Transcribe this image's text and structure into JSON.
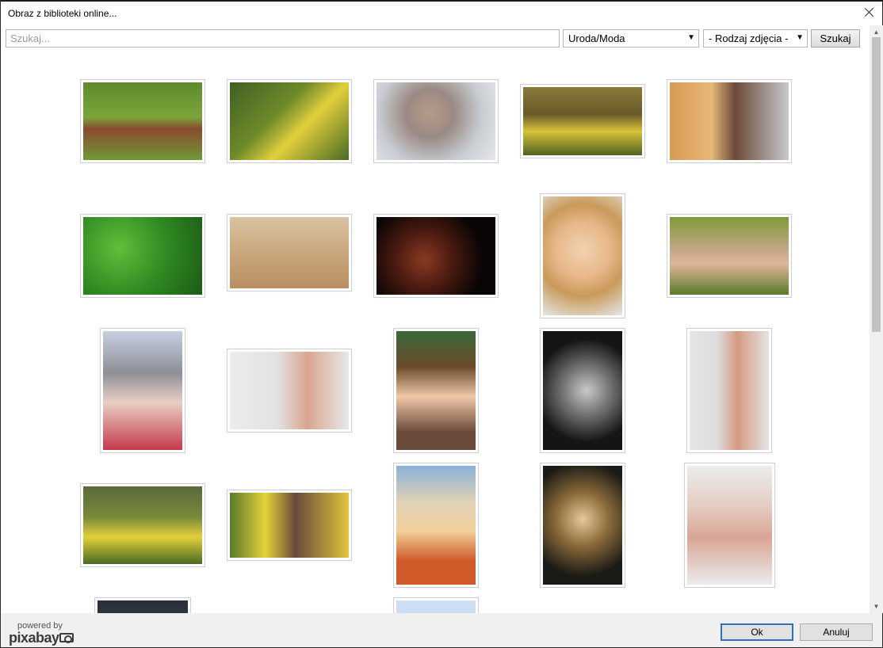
{
  "window": {
    "title": "Obraz z biblioteki online..."
  },
  "toolbar": {
    "search_placeholder": "Szukaj...",
    "category_value": "Uroda/Moda",
    "type_value": "- Rodzaj zdjęcia -",
    "search_button": "Szukaj"
  },
  "footer": {
    "powered_by": "powered by",
    "brand": "pixabay",
    "ok": "Ok",
    "cancel": "Anuluj"
  },
  "icons": {
    "close": "close-icon",
    "dropdown": "chevron-down-icon",
    "scroll_up": "arrow-up-icon",
    "scroll_down": "arrow-down-icon",
    "camera": "camera-icon"
  },
  "colors": {
    "focus_border": "#2c71c5"
  }
}
